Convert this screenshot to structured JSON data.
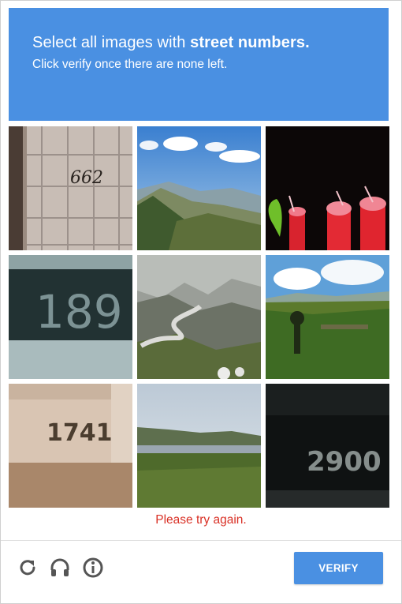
{
  "header": {
    "title_prefix": "Select all images with ",
    "title_bold": "street numbers.",
    "subtitle": "Click verify once there are none left."
  },
  "grid": {
    "tiles": [
      {
        "name": "tile-1",
        "number_text": "662"
      },
      {
        "name": "tile-2"
      },
      {
        "name": "tile-3"
      },
      {
        "name": "tile-4",
        "number_text": "189"
      },
      {
        "name": "tile-5"
      },
      {
        "name": "tile-6"
      },
      {
        "name": "tile-7",
        "number_text": "1741"
      },
      {
        "name": "tile-8"
      },
      {
        "name": "tile-9",
        "number_text": "2900"
      }
    ]
  },
  "error_message": "Please try again.",
  "footer": {
    "reload_icon": "reload-icon",
    "audio_icon": "headphones-icon",
    "info_icon": "info-icon",
    "verify_label": "VERIFY"
  },
  "colors": {
    "accent": "#4a90e2",
    "error": "#d93025",
    "icon": "#555555"
  }
}
